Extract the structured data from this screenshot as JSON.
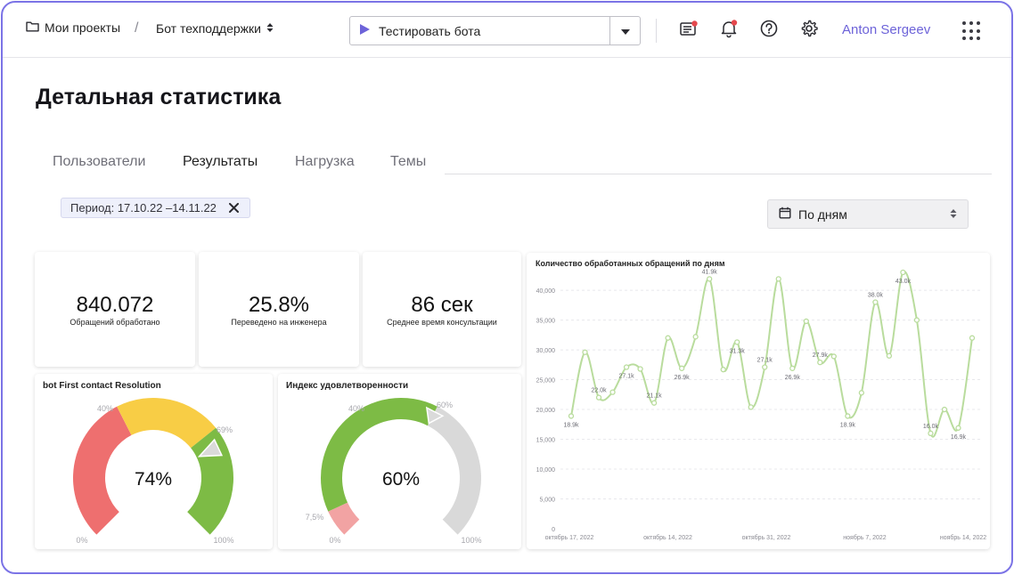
{
  "header": {
    "projects_label": "Мои проекты",
    "separator": "/",
    "bot_name": "Бот техподдержки",
    "test_label": "Тестировать бота",
    "username": "Anton Sergeev",
    "accent": "#6d63d9",
    "notification_dot": "#e5484d"
  },
  "page": {
    "title": "Детальная статистика"
  },
  "tabs": [
    {
      "label": "Пользователи"
    },
    {
      "label": "Результаты"
    },
    {
      "label": "Нагрузка"
    },
    {
      "label": "Темы"
    }
  ],
  "filters": {
    "period": "Период: 17.10.22 –14.11.22",
    "grouping": "По дням"
  },
  "kpis": [
    {
      "value": "840.072",
      "label": "Обращений обработано"
    },
    {
      "value": "25.8%",
      "label": "Переведено на инженера"
    },
    {
      "value": "86 сек",
      "label": "Среднее время консультации"
    }
  ],
  "gauges": [
    {
      "title": "bot First contact Resolution",
      "value_text": "74%",
      "value": 74,
      "labels": {
        "start": "0%",
        "end": "100%",
        "mid1": "40%",
        "mid2": "69%"
      },
      "segments": [
        {
          "from": 0,
          "to": 40,
          "color": "#ee6f6f"
        },
        {
          "from": 40,
          "to": 69,
          "color": "#f8cd45"
        },
        {
          "from": 69,
          "to": 100,
          "color": "#7dbb45"
        }
      ]
    },
    {
      "title": "Индекс удовлетворенности",
      "value_text": "60%",
      "value": 60,
      "labels": {
        "start": "0%",
        "end": "100%",
        "mid1": "40%",
        "mid2": "60%",
        "low": "7,5%"
      },
      "segments": [
        {
          "from": 0,
          "to": 7.5,
          "color": "#f2a3a3"
        },
        {
          "from": 7.5,
          "to": 60,
          "color": "#7dbb45"
        },
        {
          "from": 60,
          "to": 100,
          "color": "#d9d9d9"
        }
      ]
    }
  ],
  "chart_data": {
    "type": "line",
    "title": "Количество обработанных обращений по дням",
    "ylim": [
      0,
      43000
    ],
    "yticks": [
      0,
      5000,
      10000,
      15000,
      20000,
      25000,
      30000,
      35000,
      40000
    ],
    "ytick_labels": [
      "0",
      "5,000",
      "10,000",
      "15,000",
      "20,000",
      "25,000",
      "30,000",
      "35,000",
      "40,000"
    ],
    "x_tick_labels": [
      "октябрь 17, 2022",
      "октябрь 14, 2022",
      "октябрь 31, 2022",
      "ноябрь 7, 2022",
      "ноябрь 14, 2022"
    ],
    "color": "#b9dc9d",
    "series": [
      {
        "values": [
          18900,
          29600,
          22000,
          22900,
          27100,
          26800,
          21100,
          32000,
          26900,
          32200,
          41900,
          26700,
          31300,
          20400,
          27100,
          41900,
          26900,
          34800,
          27900,
          28900,
          18900,
          22800,
          38000,
          29000,
          43000,
          35000,
          16000,
          20000,
          16900,
          32000
        ],
        "labels": [
          "18.9k",
          "",
          "22.0k",
          "",
          "27.1k",
          "",
          "21.1k",
          "",
          "26.9k",
          "",
          "41.9k",
          "",
          "31.3k",
          "",
          "27.1k",
          "",
          "26.9k",
          "",
          "27.9k",
          "",
          "18.9k",
          "",
          "38.0k",
          "",
          "43.0k",
          "",
          "16.0k",
          "",
          "16.9k",
          ""
        ]
      }
    ],
    "grid": true
  }
}
